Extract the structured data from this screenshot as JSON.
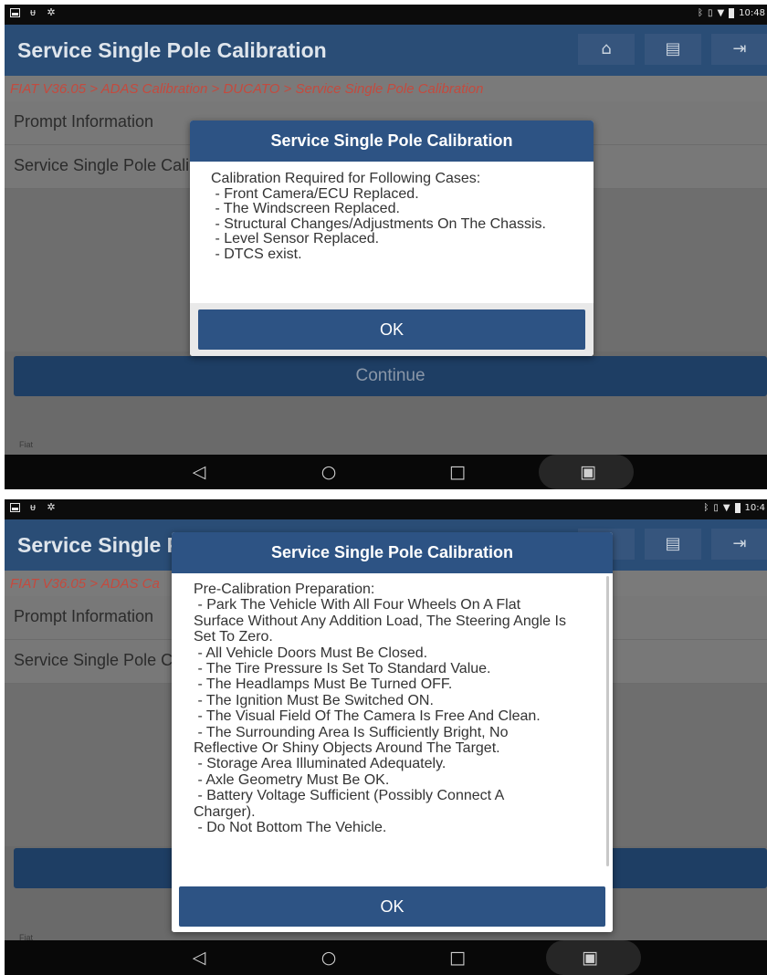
{
  "status_bar": {
    "time_1": "10:48",
    "time_2": "10:4"
  },
  "app": {
    "title": "Service Single Pole Calibration",
    "title_truncated": "Service Single P"
  },
  "toolbar": {
    "home_icon": "home-icon",
    "print_icon": "printer-icon",
    "exit_icon": "exit-icon"
  },
  "breadcrumb": {
    "text": "FIAT V36.05 > ADAS Calibration > DUCATO > Service Single Pole Calibration",
    "text_truncated": "FIAT V36.05 > ADAS Ca"
  },
  "list": {
    "row1": "Prompt Information",
    "row2": "Service Single Pole Calibration"
  },
  "continue_label": "Continue",
  "footer_brand": "Fiat",
  "dialog1": {
    "title": "Service Single Pole Calibration",
    "lines": [
      "Calibration Required for Following Cases:",
      " - Front Camera/ECU Replaced.",
      " - The Windscreen Replaced.",
      " - Structural Changes/Adjustments On The Chassis.",
      " - Level Sensor Replaced.",
      " - DTCS exist."
    ],
    "ok_label": "OK"
  },
  "dialog2": {
    "title": "Service Single Pole Calibration",
    "lines": [
      "Pre-Calibration Preparation:",
      " - Park The Vehicle With All Four Wheels On A Flat",
      "Surface Without Any Addition Load, The Steering Angle Is",
      "Set To Zero.",
      " - All Vehicle Doors Must Be Closed.",
      " - The Tire Pressure Is Set To Standard Value.",
      " - The Headlamps Must Be Turned OFF.",
      " - The Ignition Must Be Switched ON.",
      " - The Visual Field Of The Camera Is Free And Clean.",
      " - The Surrounding Area Is Sufficiently Bright, No",
      "Reflective Or Shiny Objects Around The Target.",
      " - Storage Area Illuminated Adequately.",
      " - Axle Geometry Must Be OK.",
      " - Battery Voltage Sufficient (Possibly Connect A",
      "Charger).",
      " - Do Not Bottom The Vehicle."
    ],
    "ok_label": "OK"
  },
  "nav": {
    "back_icon": "back-icon",
    "home_icon": "home-circle-icon",
    "recents_icon": "recents-icon",
    "screenshot_icon": "screenshot-icon"
  },
  "colors": {
    "accent": "#2d5384",
    "titlebar": "#2a4d76",
    "breadcrumb_text": "#c44a3e"
  }
}
